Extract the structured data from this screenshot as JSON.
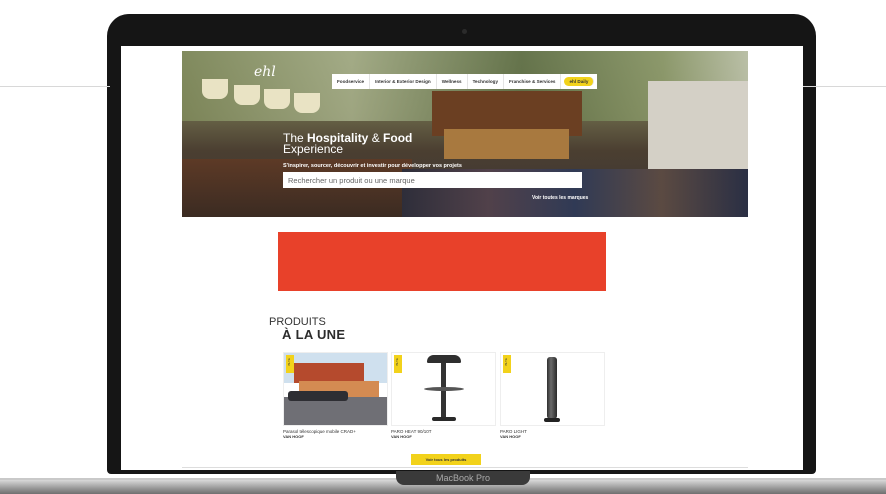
{
  "device": {
    "label": "MacBook Pro"
  },
  "header": {
    "logo_text": "ehl",
    "nav": [
      "Foodservice",
      "Interior & Exterior Design",
      "Wellness",
      "Technology",
      "Franchise & Services"
    ],
    "nav_highlight": "ehl Daily"
  },
  "hero": {
    "title_plain": "The ",
    "title_bold_1": "Hospitality",
    "title_amp": " & ",
    "title_bold_2": "Food",
    "title_line2": "Experience",
    "subtitle": "S'inspirer, sourcer, découvrir et investir pour développer vos projets",
    "search_placeholder": "Rechercher un produit ou une marque",
    "brands_link": "Voir toutes les marques"
  },
  "banner": {
    "color": "#e8412a"
  },
  "products": {
    "kicker": "PRODUITS",
    "title": "À LA UNE",
    "badge": "BLYE",
    "items": [
      {
        "name": "Parasol télescopique mobile CRAD+",
        "brand": "VAN HOOF"
      },
      {
        "name": "PARO HEAT 90/10T",
        "brand": "VAN HOOF"
      },
      {
        "name": "PARO LIGHT",
        "brand": "VAN HOOF"
      }
    ],
    "see_all": "Voir tous les produits"
  },
  "colors": {
    "accent_yellow": "#f2d21b",
    "banner_red": "#e8412a"
  }
}
